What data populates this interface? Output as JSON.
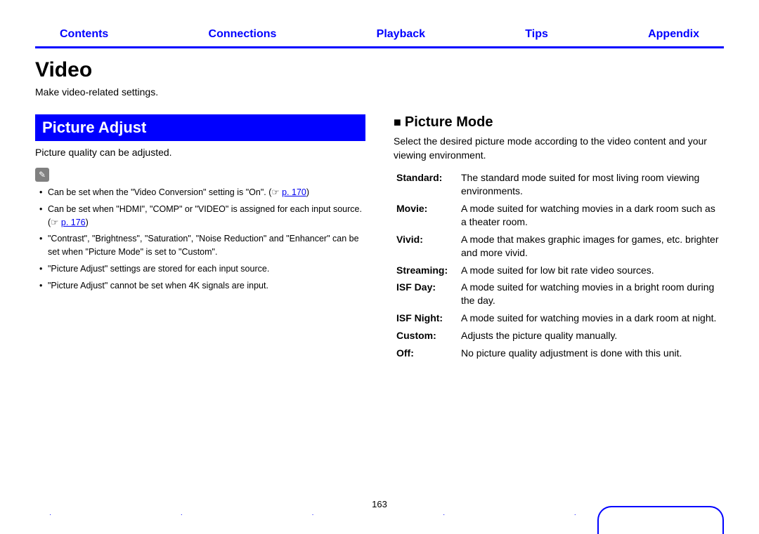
{
  "nav": {
    "contents": "Contents",
    "connections": "Connections",
    "playback": "Playback",
    "tips": "Tips",
    "appendix": "Appendix"
  },
  "title": "Video",
  "intro": "Make video-related settings.",
  "left": {
    "heading": "Picture Adjust",
    "sub": "Picture quality can be adjusted.",
    "bullets": {
      "b1a": "Can be set when the \"Video Conversion\" setting is \"On\".  (",
      "b1_ref": "p. 170",
      "b1b": ")",
      "b2a": "Can be set when \"HDMI\", \"COMP\" or \"VIDEO\" is assigned for each input source. (",
      "b2_ref": "p. 176",
      "b2b": ")",
      "b3": "\"Contrast\", \"Brightness\", \"Saturation\", \"Noise Reduction\" and \"Enhancer\" can be set when \"Picture Mode\" is set to \"Custom\".",
      "b4": "\"Picture Adjust\" settings are stored for each input source.",
      "b5": "\"Picture Adjust\" cannot be set when 4K signals are input."
    }
  },
  "right": {
    "heading": "Picture Mode",
    "desc": "Select the desired picture mode according to the video content and your viewing environment.",
    "rows": {
      "standard": {
        "k": "Standard:",
        "v": "The standard mode suited for most living room viewing environments."
      },
      "movie": {
        "k": "Movie:",
        "v": "A mode suited for watching movies in a dark room such as a theater room."
      },
      "vivid": {
        "k": "Vivid:",
        "v": "A mode that makes graphic images for games, etc. brighter and more vivid."
      },
      "streaming": {
        "k": "Streaming:",
        "v": "A mode suited for low bit rate video sources."
      },
      "isfday": {
        "k": "ISF Day:",
        "v": "A mode suited for watching movies in a bright room during the day."
      },
      "isfnight": {
        "k": "ISF Night:",
        "v": "A mode suited for watching movies in a dark room at night."
      },
      "custom": {
        "k": "Custom:",
        "v": "Adjusts the picture quality manually."
      },
      "off": {
        "k": "Off:",
        "v": "No picture quality adjustment is done with this unit."
      }
    }
  },
  "pagenum": "163"
}
